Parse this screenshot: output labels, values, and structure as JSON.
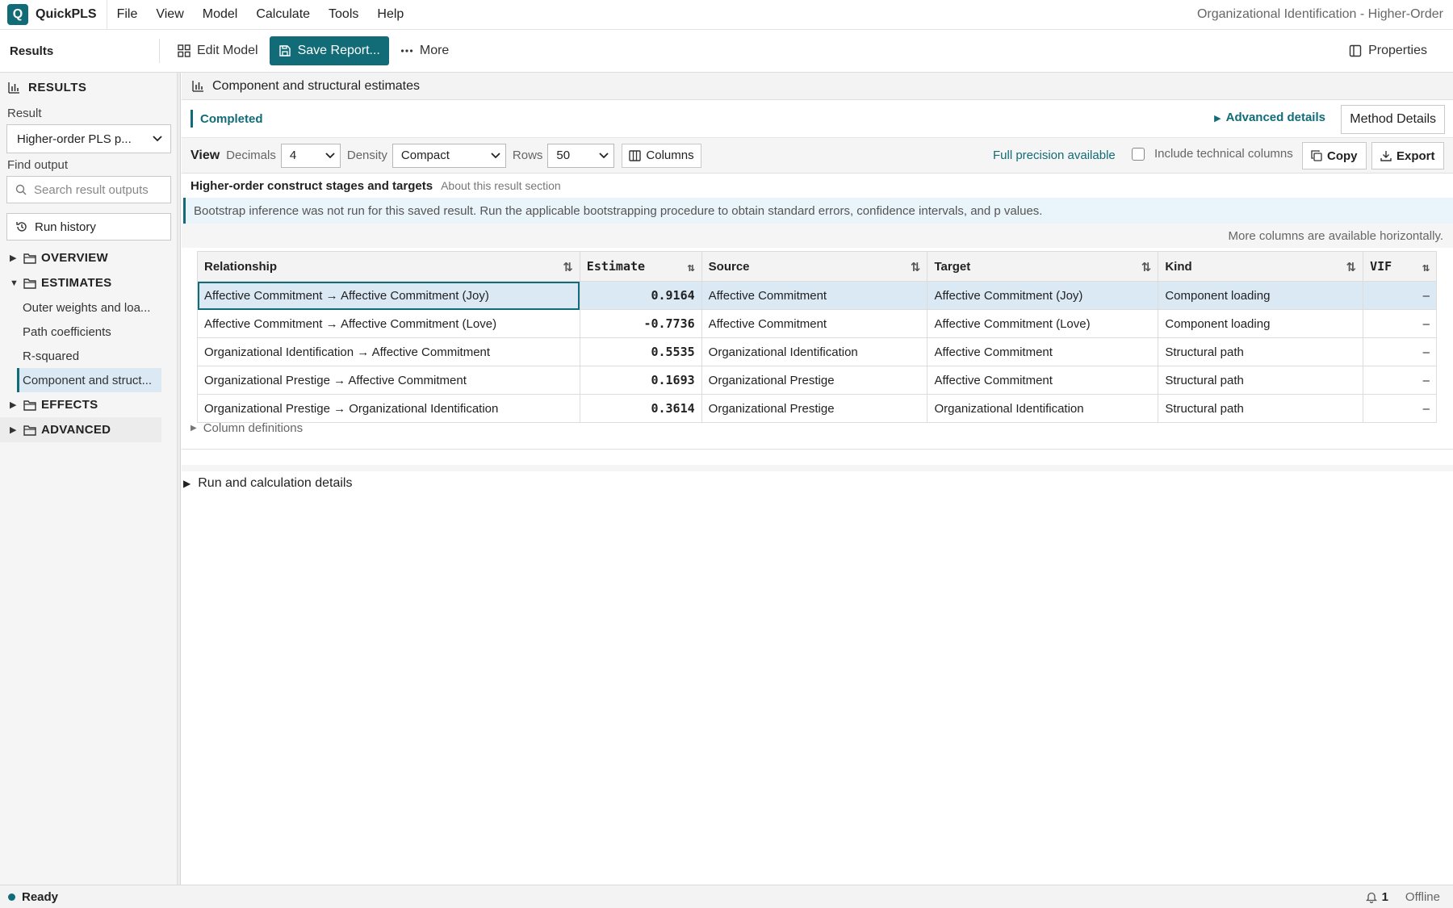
{
  "app": {
    "logo_letter": "Q",
    "name": "QuickPLS",
    "window_title": "Organizational Identification - Higher-Order"
  },
  "menu": [
    "File",
    "View",
    "Model",
    "Calculate",
    "Tools",
    "Help"
  ],
  "toolbar": {
    "title": "Results",
    "edit_model": "Edit Model",
    "save_report": "Save Report...",
    "more": "More",
    "properties": "Properties"
  },
  "sidebar": {
    "header": "RESULTS",
    "result_label": "Result",
    "result_value": "Higher-order PLS p...",
    "find_label": "Find output",
    "search_placeholder": "Search result outputs",
    "run_history": "Run history",
    "groups": {
      "overview": "OVERVIEW",
      "estimates": "ESTIMATES",
      "effects": "EFFECTS",
      "advanced": "ADVANCED"
    },
    "estimates_items": [
      "Outer weights and loa...",
      "Path coefficients",
      "R-squared",
      "Component and struct..."
    ]
  },
  "main": {
    "section_title": "Component and structural estimates",
    "status": "Completed",
    "advanced_details": "Advanced details",
    "method_details": "Method Details",
    "view": {
      "label": "View",
      "decimals_label": "Decimals",
      "decimals_value": "4",
      "density_label": "Density",
      "density_value": "Compact",
      "rows_label": "Rows",
      "rows_value": "50",
      "columns_btn": "Columns",
      "full_precision": "Full precision available",
      "include_technical": "Include technical columns",
      "copy": "Copy",
      "export": "Export"
    },
    "subsection_title": "Higher-order construct stages and targets",
    "subsection_about": "About this result section",
    "info_banner": "Bootstrap inference was not run for this saved result. Run the applicable bootstrapping procedure to obtain standard errors, confidence intervals, and p values.",
    "more_columns": "More columns are available horizontally.",
    "table": {
      "headers": [
        "Relationship",
        "Estimate",
        "Source",
        "Target",
        "Kind",
        "VIF"
      ],
      "rows": [
        [
          "Affective Commitment → Affective Commitment (Joy)",
          "0.9164",
          "Affective Commitment",
          "Affective Commitment (Joy)",
          "Component loading",
          "–"
        ],
        [
          "Affective Commitment → Affective Commitment (Love)",
          "-0.7736",
          "Affective Commitment",
          "Affective Commitment (Love)",
          "Component loading",
          "–"
        ],
        [
          "Organizational Identification → Affective Commitment",
          "0.5535",
          "Organizational Identification",
          "Affective Commitment",
          "Structural path",
          "–"
        ],
        [
          "Organizational Prestige → Affective Commitment",
          "0.1693",
          "Organizational Prestige",
          "Affective Commitment",
          "Structural path",
          "–"
        ],
        [
          "Organizational Prestige → Organizational Identification",
          "0.3614",
          "Organizational Prestige",
          "Organizational Identification",
          "Structural path",
          "–"
        ]
      ]
    },
    "column_definitions": "Column definitions",
    "run_details": "Run and calculation details"
  },
  "statusbar": {
    "ready": "Ready",
    "notifications": "1",
    "connection": "Offline"
  }
}
